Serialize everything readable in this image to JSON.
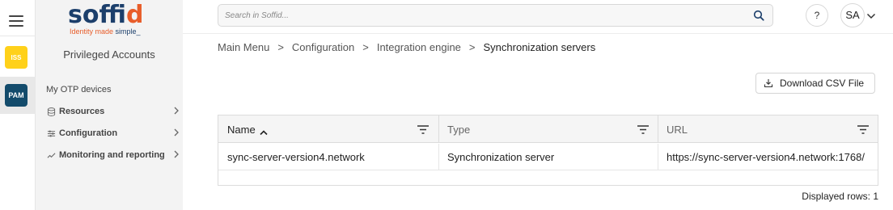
{
  "rail": {
    "apps": [
      {
        "label": "ISS",
        "color": "#ffd11a"
      },
      {
        "label": "PAM",
        "color": "#134b6b"
      }
    ]
  },
  "sidepanel": {
    "logo_word_a": "soff",
    "logo_word_b": "id",
    "logo_tag_a": "Identity made ",
    "logo_tag_b": "simple_",
    "section_title": "Privileged Accounts",
    "items": [
      {
        "label": "My OTP devices",
        "icon": "none",
        "has_submenu": false
      },
      {
        "label": "Resources",
        "icon": "database-icon",
        "has_submenu": true
      },
      {
        "label": "Configuration",
        "icon": "sliders-icon",
        "has_submenu": true
      },
      {
        "label": "Monitoring and reporting",
        "icon": "trend-icon",
        "has_submenu": true
      }
    ]
  },
  "topbar": {
    "search_placeholder": "Search in Soffid...",
    "help_label": "?",
    "avatar_initials": "SA"
  },
  "breadcrumb": {
    "items": [
      "Main Menu",
      "Configuration",
      "Integration engine"
    ],
    "separator": ">",
    "current": "Synchronization servers"
  },
  "actions": {
    "download_csv": "Download CSV File"
  },
  "table": {
    "columns": [
      {
        "label": "Name",
        "sorted": "asc"
      },
      {
        "label": "Type",
        "sorted": "none"
      },
      {
        "label": "URL",
        "sorted": "none"
      }
    ],
    "rows": [
      [
        "sync-server-version4.network",
        "Synchronization server",
        "https://sync-server-version4.network:1768/"
      ]
    ]
  },
  "footer": {
    "displayed_rows": "Displayed rows: 1"
  },
  "colors": {
    "brand_blue": "#1c3f6b",
    "brand_orange": "#e85d2a",
    "iss_yellow": "#ffd11a",
    "pam_blue": "#134b6b"
  }
}
